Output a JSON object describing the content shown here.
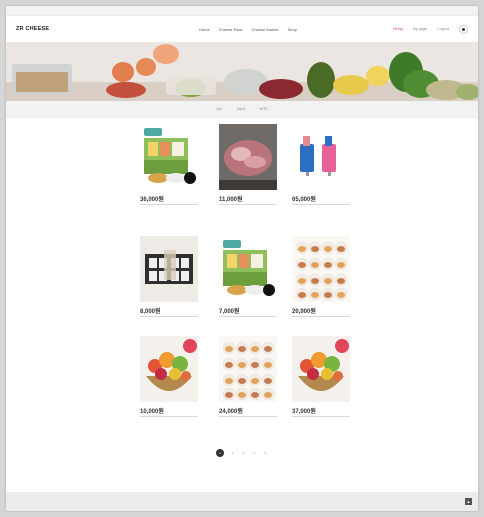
{
  "topbar": {
    "notice": ""
  },
  "header": {
    "logo": "ZR CHEESE",
    "nav": [
      "Home",
      "Cheese Pack",
      "Cheese Market",
      "Story"
    ],
    "util": [
      "Hiring",
      "My page",
      "Logout"
    ]
  },
  "subnav": {
    "items": [
      "ALL",
      "SALE",
      "HITS"
    ]
  },
  "products": [
    {
      "name": "",
      "price": "36,000원",
      "desc": "",
      "badge": "",
      "kind": "giftset"
    },
    {
      "name": "",
      "price": "11,000원",
      "desc": "",
      "badge": "",
      "kind": "meat"
    },
    {
      "name": "",
      "price": "65,000원",
      "desc": "",
      "badge": "",
      "kind": "cups"
    },
    {
      "name": "",
      "price": "8,000원",
      "desc": "",
      "badge": "",
      "kind": "box"
    },
    {
      "name": "",
      "price": "7,000원",
      "desc": "",
      "badge": "",
      "kind": "giftset"
    },
    {
      "name": "",
      "price": "20,000원",
      "desc": "",
      "badge": "",
      "kind": "jars"
    },
    {
      "name": "",
      "price": "10,000원",
      "desc": "",
      "badge": "",
      "kind": "basket"
    },
    {
      "name": "",
      "price": "24,000원",
      "desc": "",
      "badge": "",
      "kind": "jars"
    },
    {
      "name": "",
      "price": "37,000원",
      "desc": "",
      "badge": "",
      "kind": "basket"
    }
  ],
  "pagination": {
    "pages": [
      "1",
      "2",
      "3",
      "4",
      "5"
    ],
    "current": "1"
  },
  "footer": {
    "copyright": ""
  },
  "colors": {
    "accent": "#5fb6ad",
    "active": "#e0505a"
  }
}
